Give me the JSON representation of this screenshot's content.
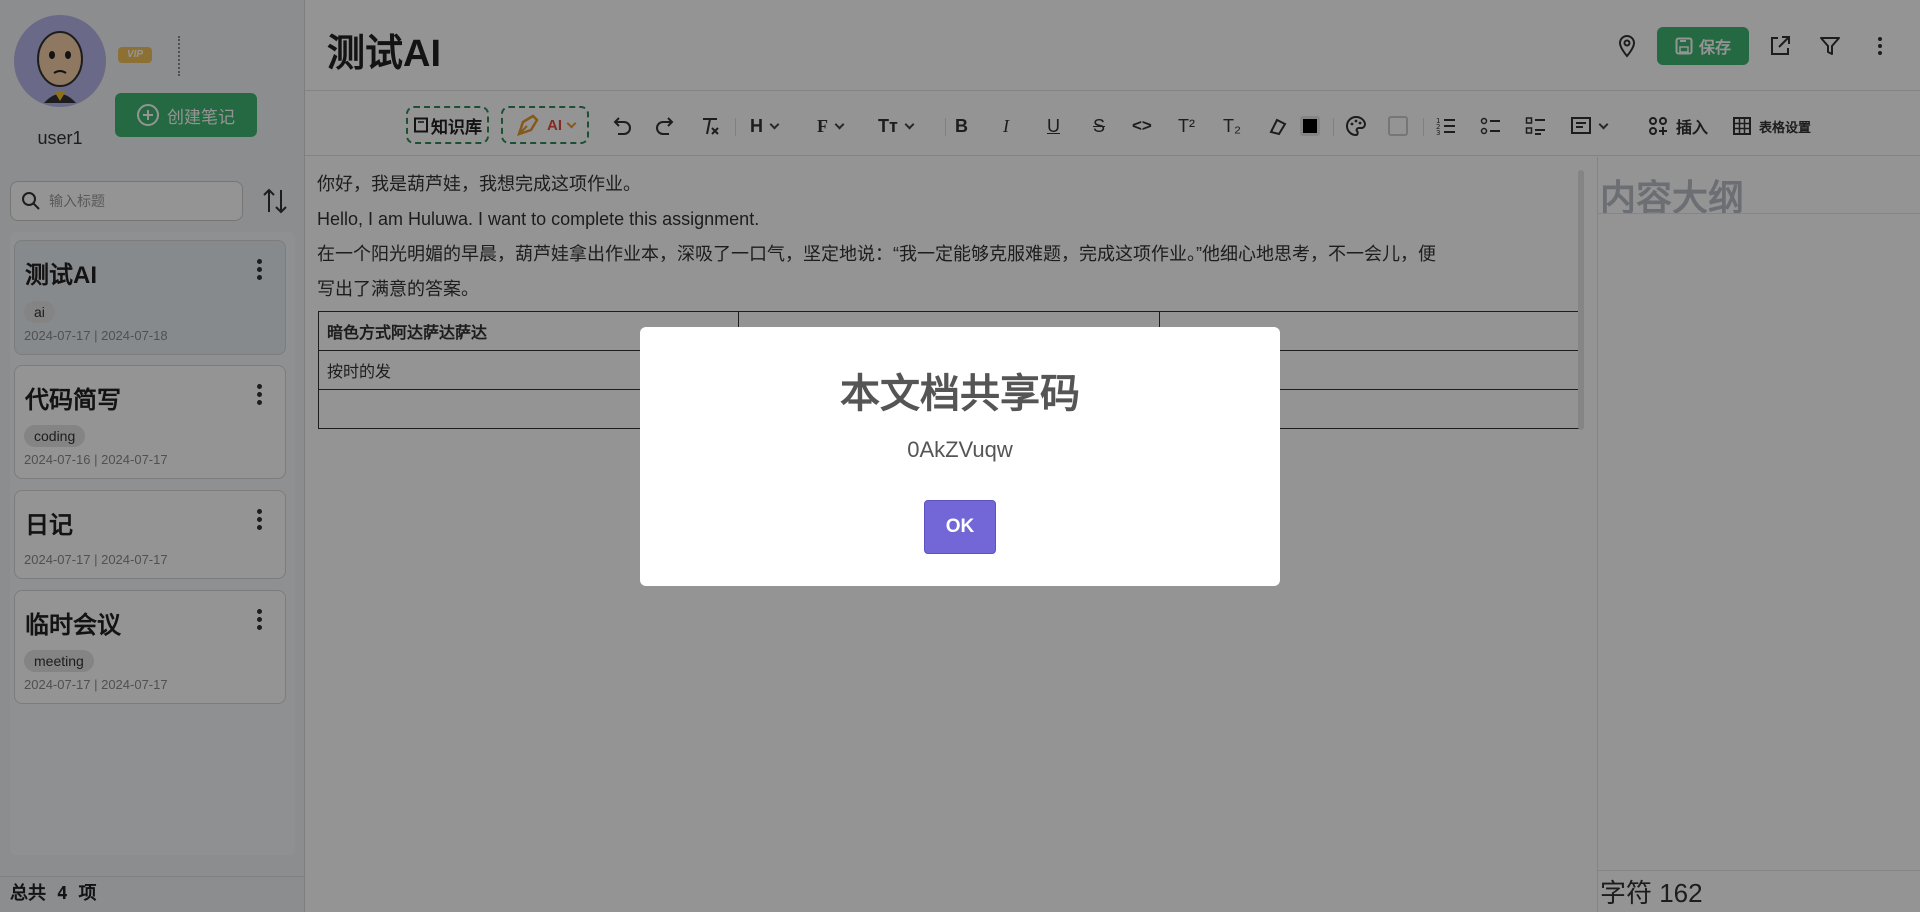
{
  "sidebar": {
    "username": "user1",
    "vip_badge": "VIP",
    "create_button": "创建笔记",
    "search": {
      "placeholder": "输入标题"
    },
    "notes": [
      {
        "title": "测试AI",
        "tag": "ai",
        "dates": "2024-07-17 | 2024-07-18",
        "active": true
      },
      {
        "title": "代码简写",
        "tag": "coding",
        "dates": "2024-07-16 | 2024-07-17"
      },
      {
        "title": "日记",
        "tag": "",
        "dates": "2024-07-17 | 2024-07-17"
      },
      {
        "title": "临时会议",
        "tag": "meeting",
        "dates": "2024-07-17 | 2024-07-17"
      }
    ],
    "total": "总共 4 项"
  },
  "header": {
    "doc_title": "测试AI",
    "save_button": "保存",
    "icons": [
      "location-icon",
      "save-icon",
      "share-icon",
      "filter-icon",
      "more-icon"
    ]
  },
  "toolbar": {
    "knowledge_base": "知识库",
    "ai": "AI",
    "heading": "H",
    "font": "F",
    "font_size": "Tт",
    "bold": "B",
    "italic": "I",
    "underline": "U",
    "strike": "S",
    "code": "<>",
    "superscript": "T²",
    "subscript": "T₂",
    "insert": "插入",
    "table_settings": "表格设置",
    "text_color": "#000000",
    "bg_color": "#ffffff"
  },
  "editor": {
    "paragraphs": [
      "你好，我是葫芦娃，我想完成这项作业。",
      "Hello, I am Huluwa. I want to complete this assignment.",
      "在一个阳光明媚的早晨，葫芦娃拿出作业本，深吸了一口气，坚定地说：“我一定能够克服难题，完成这项作业。”他细心地思考，不一会儿，便",
      "写出了满意的答案。"
    ],
    "table": [
      [
        "暗色方式阿达萨达萨达",
        "",
        ""
      ],
      [
        "按时的发",
        "",
        ""
      ],
      [
        "",
        "",
        ""
      ]
    ]
  },
  "outline": {
    "title": "内容大纲",
    "char_count": "字符 162"
  },
  "modal": {
    "title": "本文档共享码",
    "code": "0AkZVuqw",
    "ok_button": "OK"
  },
  "colors": {
    "accent_green": "#3fb670",
    "ok_purple": "#7367d8",
    "dashed_border": "#2f8a5a"
  }
}
